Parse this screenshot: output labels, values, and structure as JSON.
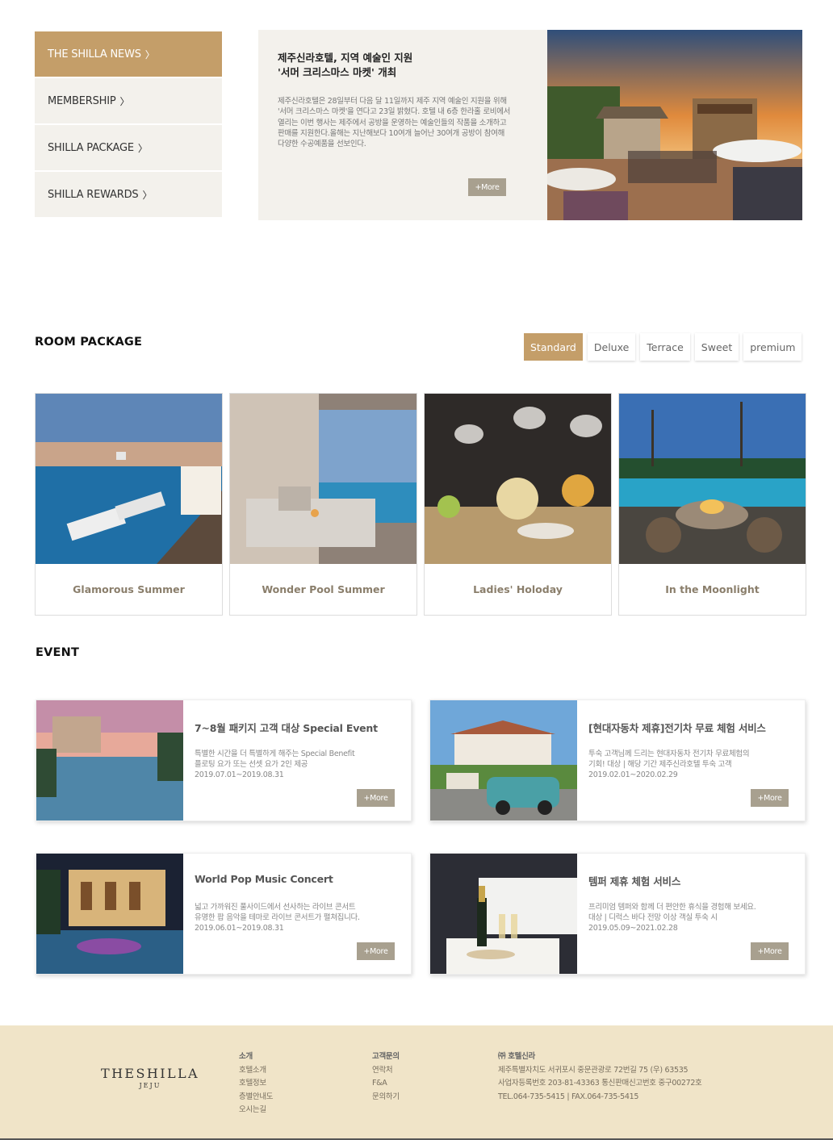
{
  "side_menu": {
    "items": [
      {
        "label": "THE SHILLA NEWS"
      },
      {
        "label": "MEMBERSHIP"
      },
      {
        "label": "SHILLA PACKAGE"
      },
      {
        "label": "SHILLA REWARDS"
      }
    ],
    "chevron": "〉"
  },
  "news": {
    "title_line1": "제주신라호텔, 지역 예술인 지원",
    "title_line2": "'서머 크리스마스 마켓' 개최",
    "body": "제주신라호텔은 28일부터 다음 달 11일까지 제주 지역 예술인 지원을 위해 '서머 크리스마스 마켓'을 연다고 23일 밝혔다. 호텔 내 6층 한라홀 로비에서 열리는 이번 행사는 제주에서 공방을 운영하는 예술인들의 작품을 소개하고 판매를 지원한다.올해는 지난해보다 10여개 늘어난 30여개 공방이 참여해 다양한 수공예품을 선보인다.",
    "more": "+More"
  },
  "room_package": {
    "title": "ROOM PACKAGE",
    "tabs": [
      "Standard",
      "Deluxe",
      "Terrace",
      "Sweet",
      "premium"
    ],
    "cards": [
      {
        "label": "Glamorous Summer"
      },
      {
        "label": "Wonder Pool Summer"
      },
      {
        "label": "Ladies' Holoday"
      },
      {
        "label": "In the Moonlight"
      }
    ]
  },
  "event": {
    "title": "EVENT",
    "items": [
      {
        "title": "7~8월 패키지 고객 대상 Special Event",
        "desc1": "특별한 시간을 더 특별하게 해주는 Special Benefit",
        "desc2": "플로팅 요가 또는 선셋 요가 2인 제공",
        "date": "2019.07.01~2019.08.31",
        "more": "+More"
      },
      {
        "title": "[현대자동차 제휴]전기차 무료 체험 서비스",
        "desc1": "투숙 고객님께 드리는 현대자동차 전기차 무료체험의",
        "desc2": "기회! 대상 | 해당 기간 제주신라호텔 투숙 고객",
        "date": "2019.02.01~2020.02.29",
        "more": "+More"
      },
      {
        "title": "World Pop Music Concert",
        "desc1": "넓고 가까워진 풀사이드에서 선사하는 라이브 콘서트",
        "desc2": "유명한 팝 음악을 테마로 라이브 콘서트가 펼쳐집니다.",
        "date": "2019.06.01~2019.08.31",
        "more": "+More"
      },
      {
        "title": "템퍼 제휴 체험 서비스",
        "desc1": "프리미엄 템퍼와 함께 더 편안한 휴식을 경험해 보세요.",
        "desc2": "대상 | 디럭스 바다 전망 이상 객실 투숙 시",
        "date": "2019.05.09~2021.02.28",
        "more": "+More"
      }
    ]
  },
  "footer": {
    "logo_main": "THESHILLA",
    "logo_sub": "JEJU",
    "col1": {
      "head": "소개",
      "links": [
        "호텔소개",
        "호텔정보",
        "층별안내도",
        "오시는길"
      ]
    },
    "col2": {
      "head": "고객문의",
      "links": [
        "연락처",
        "F&A",
        "문의하기"
      ]
    },
    "col3": {
      "head": "㈜ 호텔신라",
      "lines": [
        "제주특별자치도 서귀포시 중문관광로 72번길 75 (우) 63535",
        "사업자등록번호 203-81-43363 통신판매신고번호 중구00272호",
        "TEL.064-735-5415 | FAX.064-735-5415"
      ]
    }
  },
  "colors": {
    "accent": "#c49e69",
    "panel": "#f3f1ec",
    "button": "#a8a08f",
    "footer_bg": "#f0e4c8"
  }
}
